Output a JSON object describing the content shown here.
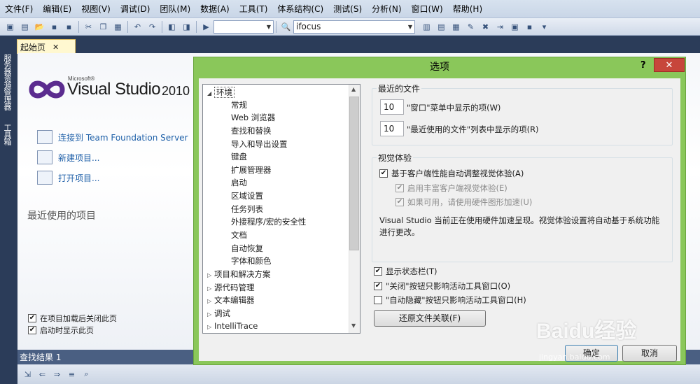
{
  "menubar": {
    "items": [
      "文件(F)",
      "编辑(E)",
      "视图(V)",
      "调试(D)",
      "团队(M)",
      "数据(A)",
      "工具(T)",
      "体系结构(C)",
      "测试(S)",
      "分析(N)",
      "窗口(W)",
      "帮助(H)"
    ]
  },
  "toolbar": {
    "config_combo": "",
    "find_combo": "ifocus"
  },
  "leftstrip": {
    "server_explorer": "服务器资源管理器",
    "toolbox": "工具箱"
  },
  "tabs": {
    "start_page": "起始页",
    "close_glyph": "✕"
  },
  "startpage": {
    "logo_microsoft": "Microsoft®",
    "logo_product": "Visual Studio",
    "logo_year": "2010",
    "links": [
      "连接到 Team Foundation Server",
      "新建项目...",
      "打开项目..."
    ],
    "recent_title": "最近使用的项目",
    "close_after_load": "在项目加载后关闭此页",
    "show_on_startup": "启动时显示此页"
  },
  "findresults": {
    "title": "查找结果 1"
  },
  "dialog": {
    "title": "选项",
    "help": "?",
    "close": "✕",
    "tree": {
      "root": "环境",
      "children": [
        "常规",
        "Web 浏览器",
        "查找和替换",
        "导入和导出设置",
        "键盘",
        "扩展管理器",
        "启动",
        "区域设置",
        "任务列表",
        "外接程序/宏的安全性",
        "文档",
        "自动恢复",
        "字体和颜色"
      ],
      "siblings": [
        "项目和解决方案",
        "源代码管理",
        "文本编辑器",
        "调试",
        "IntelliTrace"
      ]
    },
    "recent_files": {
      "title": "最近的文件",
      "window_menu_count": "10",
      "window_menu_label": "\"窗口\"菜单中显示的项(W)",
      "mru_count": "10",
      "mru_label": "\"最近使用的文件\"列表中显示的项(R)"
    },
    "visual_experience": {
      "title": "视觉体验",
      "auto_adjust": "基于客户端性能自动调整视觉体验(A)",
      "rich_client": "启用丰富客户端视觉体验(E)",
      "hw_accel": "如果可用，请使用硬件图形加速(U)",
      "description": "Visual Studio 当前正在使用硬件加速呈现。视觉体验设置将自动基于系统功能进行更改。"
    },
    "show_status_bar": "显示状态栏(T)",
    "close_button_active": "\"关闭\"按钮只影响活动工具窗口(O)",
    "autohide_button_active": "\"自动隐藏\"按钮只影响活动工具窗口(H)",
    "restore_assoc": "还原文件关联(F)",
    "ok": "确定",
    "cancel": "取消",
    "check_mark": "✔"
  },
  "watermark": {
    "brand": "Baidu经验",
    "url": "jingyan.baidu.com"
  }
}
